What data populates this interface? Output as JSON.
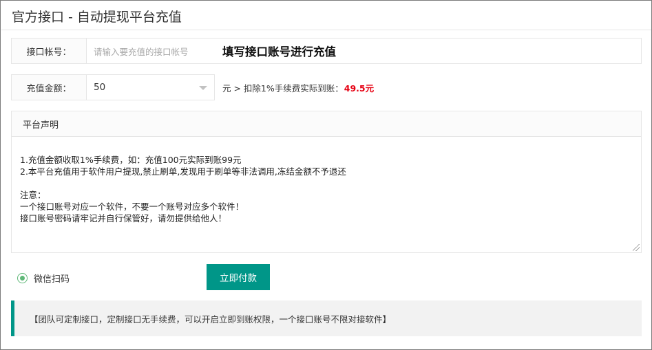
{
  "page": {
    "title": "官方接口 - 自动提现平台充值"
  },
  "account_row": {
    "label": "接口帐号：",
    "placeholder": "请输入要充值的接口帐号",
    "hint": "填写接口账号进行充值"
  },
  "amount_row": {
    "label": "充值金额：",
    "selected": "50",
    "note_prefix": "元 > 扣除1%手续费实际到账：",
    "net_amount": "49.5元"
  },
  "statement": {
    "title": "平台声明",
    "body": "1.充值金额收取1%手续费，如：充值100元实际到账99元\n2.本平台充值用于软件用户提现,禁止刷单,发现用于刷单等非法调用,冻结金额不予退还\n\n注意：\n一个接口账号对应一个软件，不要一个账号对应多个软件！\n接口账号密码请牢记并自行保管好，请勿提供给他人！"
  },
  "payment": {
    "method_label": "微信扫码",
    "pay_button": "立即付款"
  },
  "notice": {
    "text": "【团队可定制接口，定制接口无手续费，可以开启立即到账权限，一个接口账号不限对接软件】"
  },
  "colors": {
    "accent": "#009688",
    "radio": "#5fb878",
    "highlight": "#e60012"
  }
}
